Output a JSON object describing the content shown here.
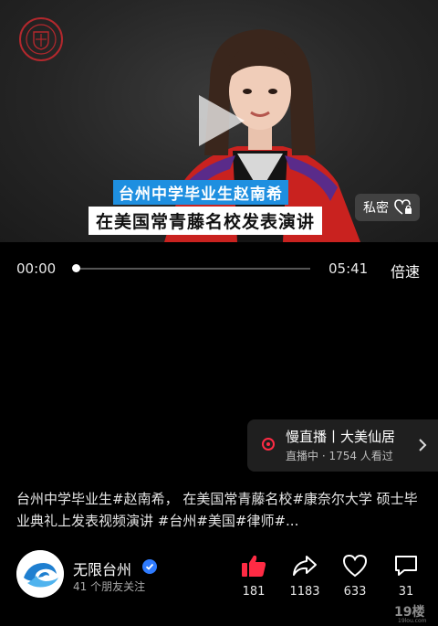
{
  "player": {
    "caption_line1": "台州中学毕业生赵南希",
    "caption_line2": "在美国常青藤名校发表演讲",
    "private_label": "私密",
    "current_time": "00:00",
    "total_time": "05:41",
    "speed_label": "倍速",
    "progress": 0
  },
  "live": {
    "title": "慢直播丨大美仙居",
    "subtitle": "直播中 · 1754 人看过"
  },
  "post": {
    "description": "台州中学毕业生#赵南希， 在美国常青藤名校#康奈尔大学 硕士毕业典礼上发表视频演讲 #台州#美国#律师#..."
  },
  "author": {
    "name": "无限台州",
    "friends_text": "41 个朋友关注"
  },
  "actions": {
    "likes": "181",
    "shares": "1183",
    "favorites": "633",
    "comments": "31"
  },
  "colors": {
    "like_red": "#ff2b44",
    "caption_blue": "#1e8fe0",
    "verified_blue": "#2e7bff"
  }
}
